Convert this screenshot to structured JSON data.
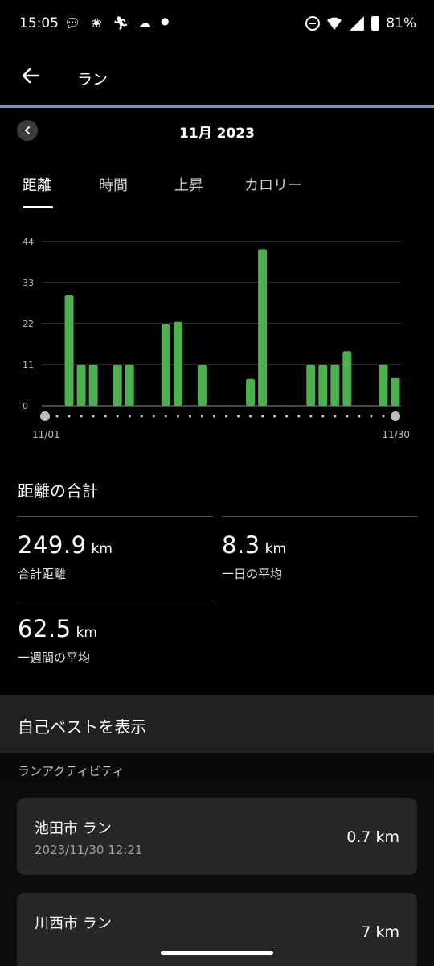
{
  "status_bar": {
    "time": "15:05",
    "battery": "81%",
    "icons": [
      "chat-icon",
      "pinwheel-icon",
      "runner-icon",
      "weather-icon",
      "dot-icon",
      "dnd-icon",
      "wifi-icon",
      "signal-icon",
      "battery-icon"
    ]
  },
  "app_bar": {
    "title": "ラン",
    "back_icon": "arrow-left-icon"
  },
  "month_selector": {
    "label": "11月 2023"
  },
  "tabs": [
    {
      "label": "距離",
      "active": true
    },
    {
      "label": "時間",
      "active": false
    },
    {
      "label": "上昇",
      "active": false
    },
    {
      "label": "カロリー",
      "active": false
    }
  ],
  "chart_data": {
    "type": "bar",
    "x_start_label": "11/01",
    "x_end_label": "11/30",
    "days": 30,
    "yticks": [
      0,
      11,
      22,
      33,
      44
    ],
    "ylim": [
      0,
      44
    ],
    "color": "#4caf50",
    "values": [
      0,
      0,
      29.6,
      11,
      11,
      0,
      11,
      11,
      0,
      0,
      21.8,
      22.5,
      0,
      11,
      0,
      0,
      0,
      7.2,
      42,
      0,
      0,
      0,
      11,
      11,
      11,
      14.6,
      0,
      0,
      11,
      7.6
    ]
  },
  "totals": {
    "title": "距離の合計",
    "stats": [
      {
        "value": "249.9",
        "unit": "km",
        "label": "合計距離"
      },
      {
        "value": "8.3",
        "unit": "km",
        "label": "一日の平均"
      },
      {
        "value": "62.5",
        "unit": "km",
        "label": "一週間の平均"
      }
    ]
  },
  "personal_best": {
    "label": "自己ベストを表示"
  },
  "activities": {
    "header": "ランアクティビティ",
    "items": [
      {
        "title": "池田市 ラン",
        "date": "2023/11/30 12:21",
        "distance": "0.7 km"
      },
      {
        "title": "川西市 ラン",
        "date": "",
        "distance": "7 km"
      }
    ]
  }
}
